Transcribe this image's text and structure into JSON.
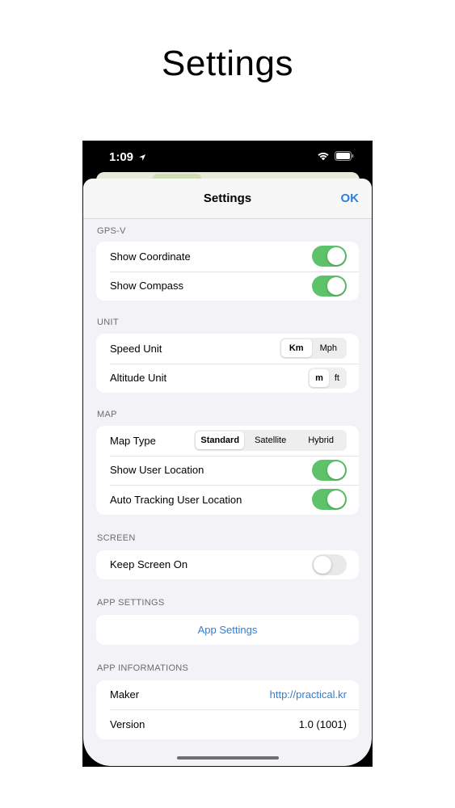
{
  "hero": {
    "title": "Settings"
  },
  "status_bar": {
    "time": "1:09"
  },
  "nav": {
    "title": "Settings",
    "ok_label": "OK"
  },
  "sections": {
    "gps": {
      "header": "GPS-V",
      "show_coordinate": {
        "label": "Show Coordinate",
        "on": true
      },
      "show_compass": {
        "label": "Show Compass",
        "on": true
      }
    },
    "unit": {
      "header": "UNIT",
      "speed": {
        "label": "Speed Unit",
        "options": [
          "Km",
          "Mph"
        ],
        "selected": "Km"
      },
      "altitude": {
        "label": "Altitude Unit",
        "options": [
          "m",
          "ft"
        ],
        "selected": "m"
      }
    },
    "map": {
      "header": "MAP",
      "map_type": {
        "label": "Map Type",
        "options": [
          "Standard",
          "Satellite",
          "Hybrid"
        ],
        "selected": "Standard"
      },
      "show_user_location": {
        "label": "Show User Location",
        "on": true
      },
      "auto_tracking": {
        "label": "Auto Tracking User Location",
        "on": true
      }
    },
    "screen": {
      "header": "SCREEN",
      "keep_screen_on": {
        "label": "Keep Screen On",
        "on": false
      }
    },
    "app_settings": {
      "header": "APP SETTINGS",
      "button_label": "App Settings"
    },
    "app_info": {
      "header": "APP INFORMATIONS",
      "maker": {
        "label": "Maker",
        "value": "http://practical.kr"
      },
      "version": {
        "label": "Version",
        "value": "1.0 (1001)"
      }
    }
  },
  "colors": {
    "accent": "#2f7fd6",
    "toggle_on": "#5ec26a",
    "toggle_off": "#e9e9ea",
    "grouped_bg": "#f2f2f7"
  }
}
